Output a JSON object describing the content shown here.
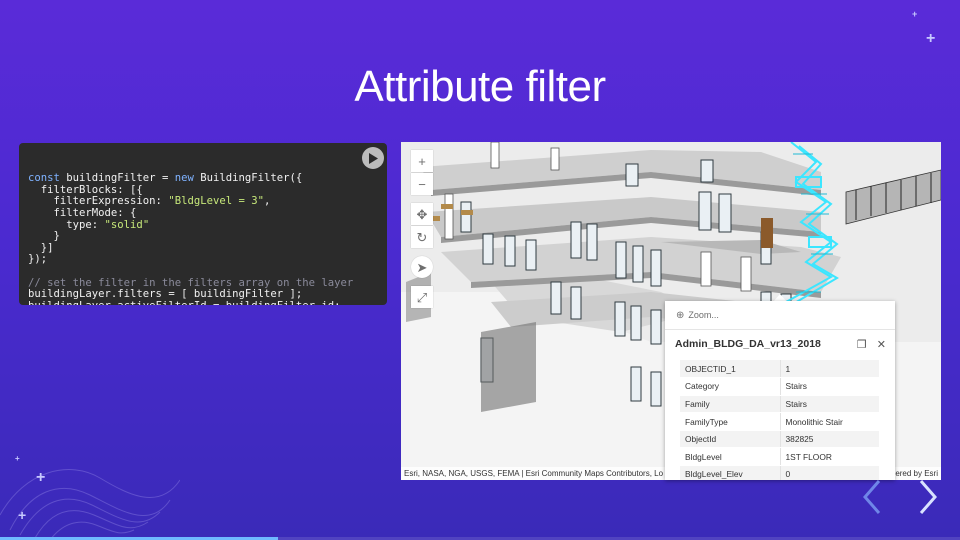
{
  "slide": {
    "title": "Attribute filter",
    "progress": 0.29
  },
  "code": {
    "lines": [
      [
        {
          "t": "const",
          "c": "kw"
        },
        {
          "t": " buildingFilter = ",
          "c": ""
        },
        {
          "t": "new",
          "c": "kw"
        },
        {
          "t": " BuildingFilter({",
          "c": ""
        }
      ],
      [
        {
          "t": "  filterBlocks: [{",
          "c": ""
        }
      ],
      [
        {
          "t": "    filterExpression: ",
          "c": ""
        },
        {
          "t": "\"BldgLevel = 3\"",
          "c": "str"
        },
        {
          "t": ",",
          "c": ""
        }
      ],
      [
        {
          "t": "    filterMode: {",
          "c": ""
        }
      ],
      [
        {
          "t": "      type: ",
          "c": ""
        },
        {
          "t": "\"solid\"",
          "c": "str"
        }
      ],
      [
        {
          "t": "    }",
          "c": ""
        }
      ],
      [
        {
          "t": "  }]",
          "c": ""
        }
      ],
      [
        {
          "t": "});",
          "c": ""
        }
      ],
      [
        {
          "t": "",
          "c": ""
        }
      ],
      [
        {
          "t": "// set the filter in the filters array on the layer",
          "c": "com"
        }
      ],
      [
        {
          "t": "buildingLayer.filters = [ buildingFilter ];",
          "c": ""
        }
      ],
      [
        {
          "t": "buildingLayer.activeFilterId = buildingFilter.id;",
          "c": ""
        }
      ]
    ],
    "play_icon": "play-icon"
  },
  "map": {
    "toolbar": [
      {
        "name": "zoom-in",
        "glyph": "+"
      },
      {
        "name": "zoom-out",
        "glyph": "−"
      },
      {
        "name": "pan",
        "glyph": "✥"
      },
      {
        "name": "rotate",
        "glyph": "↻"
      },
      {
        "name": "compass",
        "glyph": "➤"
      },
      {
        "name": "fullscreen",
        "glyph": "⤢"
      }
    ],
    "attribution_left": "Esri, NASA, NGA, USGS, FEMA | Esri Community Maps Contributors, Lo",
    "attribution_right": "ered by Esri",
    "highlight_color": "#3ce6ff"
  },
  "popup": {
    "zoom_label": "Zoom...",
    "title": "Admin_BLDG_DA_vr13_2018",
    "rows": [
      {
        "k": "OBJECTID_1",
        "v": "1"
      },
      {
        "k": "Category",
        "v": "Stairs"
      },
      {
        "k": "Family",
        "v": "Stairs"
      },
      {
        "k": "FamilyType",
        "v": "Monolithic Stair"
      },
      {
        "k": "ObjectId",
        "v": "382825"
      },
      {
        "k": "BldgLevel",
        "v": "1ST FLOOR"
      },
      {
        "k": "BldgLevel_Elev",
        "v": "0"
      }
    ]
  },
  "colors": {
    "background_top": "#5a2bd8",
    "background_bottom": "#3a2ab8",
    "code_bg": "#2b2b2b",
    "progress": "#6fb9ff"
  }
}
